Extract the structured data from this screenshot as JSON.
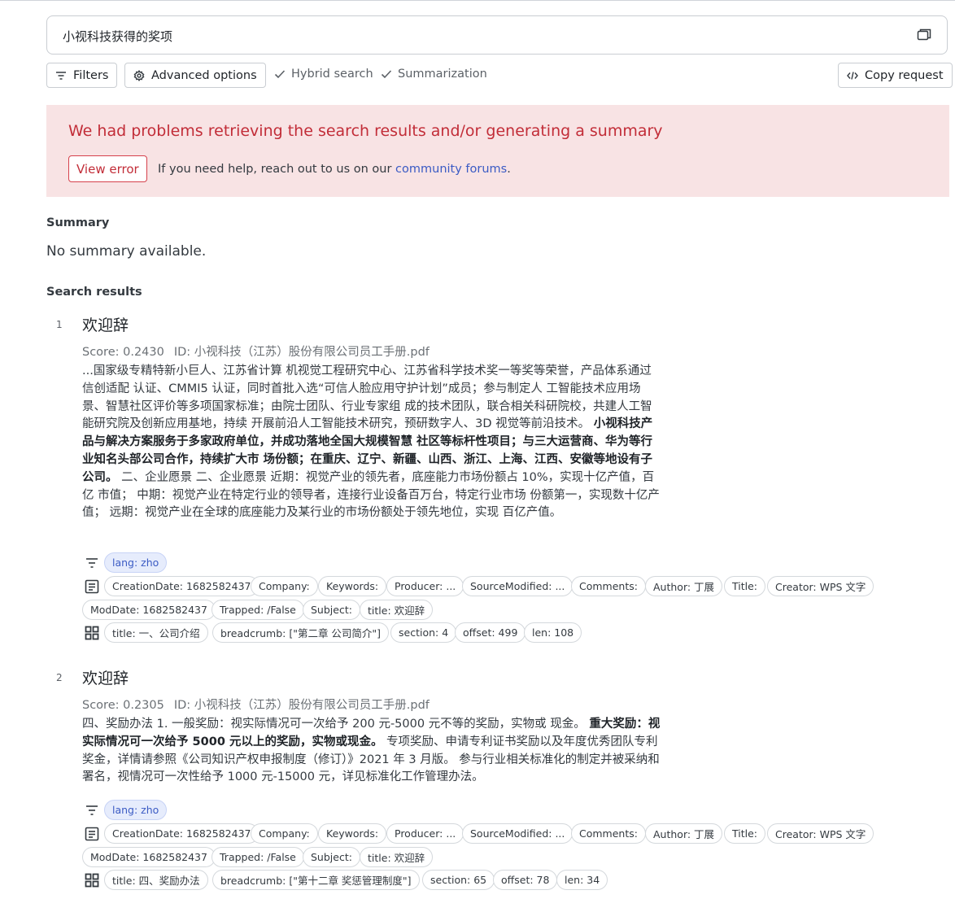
{
  "query": {
    "text": "小视科技获得的奖项",
    "icon": "chat-bubbles-icon"
  },
  "toolbar": {
    "filters_label": "Filters",
    "advanced_label": "Advanced options",
    "hybrid_label": "Hybrid search",
    "summarization_label": "Summarization",
    "copy_label": "Copy request"
  },
  "error": {
    "message": "We had problems retrieving the search results and/or generating a summary",
    "view_error_label": "View error",
    "help_prefix": "If you need help, reach out to us on our ",
    "help_link": "community forums",
    "help_suffix": "."
  },
  "summary": {
    "heading": "Summary",
    "text": "No summary available."
  },
  "results_heading": "Search results",
  "results": [
    {
      "number": "1",
      "title": "欢迎辞",
      "score": "Score: 0.2430",
      "id": "ID: 小视科技（江苏）股份有限公司员工手册.pdf",
      "snippet_pre": "...国家级专精特新小巨人、江苏省计算 机视觉工程研究中心、江苏省科学技术奖一等奖等荣誉，产品体系通过信创适配 认证、CMMI5 认证，同时首批入选“可信人脸应用守护计划”成员；参与制定人 工智能技术应用场景、智慧社区评价等多项国家标准；由院士团队、行业专家组 成的技术团队，联合相关科研院校，共建人工智能研究院及创新应用基地，持续 开展前沿人工智能技术研究，预研数字人、3D 视觉等前沿技术。 ",
      "snippet_bold": "小视科技产品与解决方案服务于多家政府单位，并成功落地全国大规模智慧 社区等标杆性项目；与三大运营商、华为等行业知名头部公司合作，持续扩大市 场份额；在重庆、辽宁、新疆、山西、浙江、上海、江西、安徽等地设有子公司。",
      "snippet_post": " 二、企业愿景 二、企业愿景 近期：视觉产业的领先者，底座能力市场份额占 10%，实现十亿产值，百亿 市值； 中期：视觉产业在特定行业的领导者，连接行业设备百万台，特定行业市场 份额第一，实现数十亿产值； 远期：视觉产业在全球的底座能力及某行业的市场份额处于领先地位，实现 百亿产值。",
      "lang_tags": [
        "lang: zho"
      ],
      "doc_tags_1": [
        "CreationDate: 1682582437",
        "Company:",
        "Keywords:",
        "Producer: ...",
        "SourceModified: ...",
        "Comments:",
        "Author: 丁展",
        "Title:",
        "Creator: WPS 文字"
      ],
      "doc_tags_2": [
        "ModDate: 1682582437",
        "Trapped: /False",
        "Subject:",
        "title: 欢迎辞"
      ],
      "part_tags": [
        "title: 一、公司介绍",
        "breadcrumb: [\"第二章 公司简介\"]",
        "section: 4",
        "offset: 499",
        "len: 108"
      ]
    },
    {
      "number": "2",
      "title": "欢迎辞",
      "score": "Score: 0.2305",
      "id": "ID: 小视科技（江苏）股份有限公司员工手册.pdf",
      "snippet_pre": "四、奖励办法 1. 一般奖励：视实际情况可一次给予 200 元-5000 元不等的奖励，实物或 现金。 ",
      "snippet_bold": "重大奖励：视实际情况可一次给予 5000 元以上的奖励，实物或现金。",
      "snippet_post": " 专项奖励、申请专利证书奖励以及年度优秀团队专利奖金，详情请参照《公司知识产权申报制度（修订）》2021 年 3 月版。 参与行业相关标准化的制定并被采纳和署名，视情况可一次性给予 1000 元-15000 元，详见标准化工作管理办法。",
      "lang_tags": [
        "lang: zho"
      ],
      "doc_tags_1": [
        "CreationDate: 1682582437",
        "Company:",
        "Keywords:",
        "Producer: ...",
        "SourceModified: ...",
        "Comments:",
        "Author: 丁展",
        "Title:",
        "Creator: WPS 文字"
      ],
      "doc_tags_2": [
        "ModDate: 1682582437",
        "Trapped: /False",
        "Subject:",
        "title: 欢迎辞"
      ],
      "part_tags": [
        "title: 四、奖励办法",
        "breadcrumb: [\"第十二章 奖惩管理制度\"]",
        "section: 65",
        "offset: 78",
        "len: 34"
      ]
    }
  ],
  "colors": {
    "error_bg": "#f8e3e4",
    "error_text": "#c22d38",
    "link": "#3b5bc4",
    "lang_tag_bg": "#e6ecfc"
  }
}
